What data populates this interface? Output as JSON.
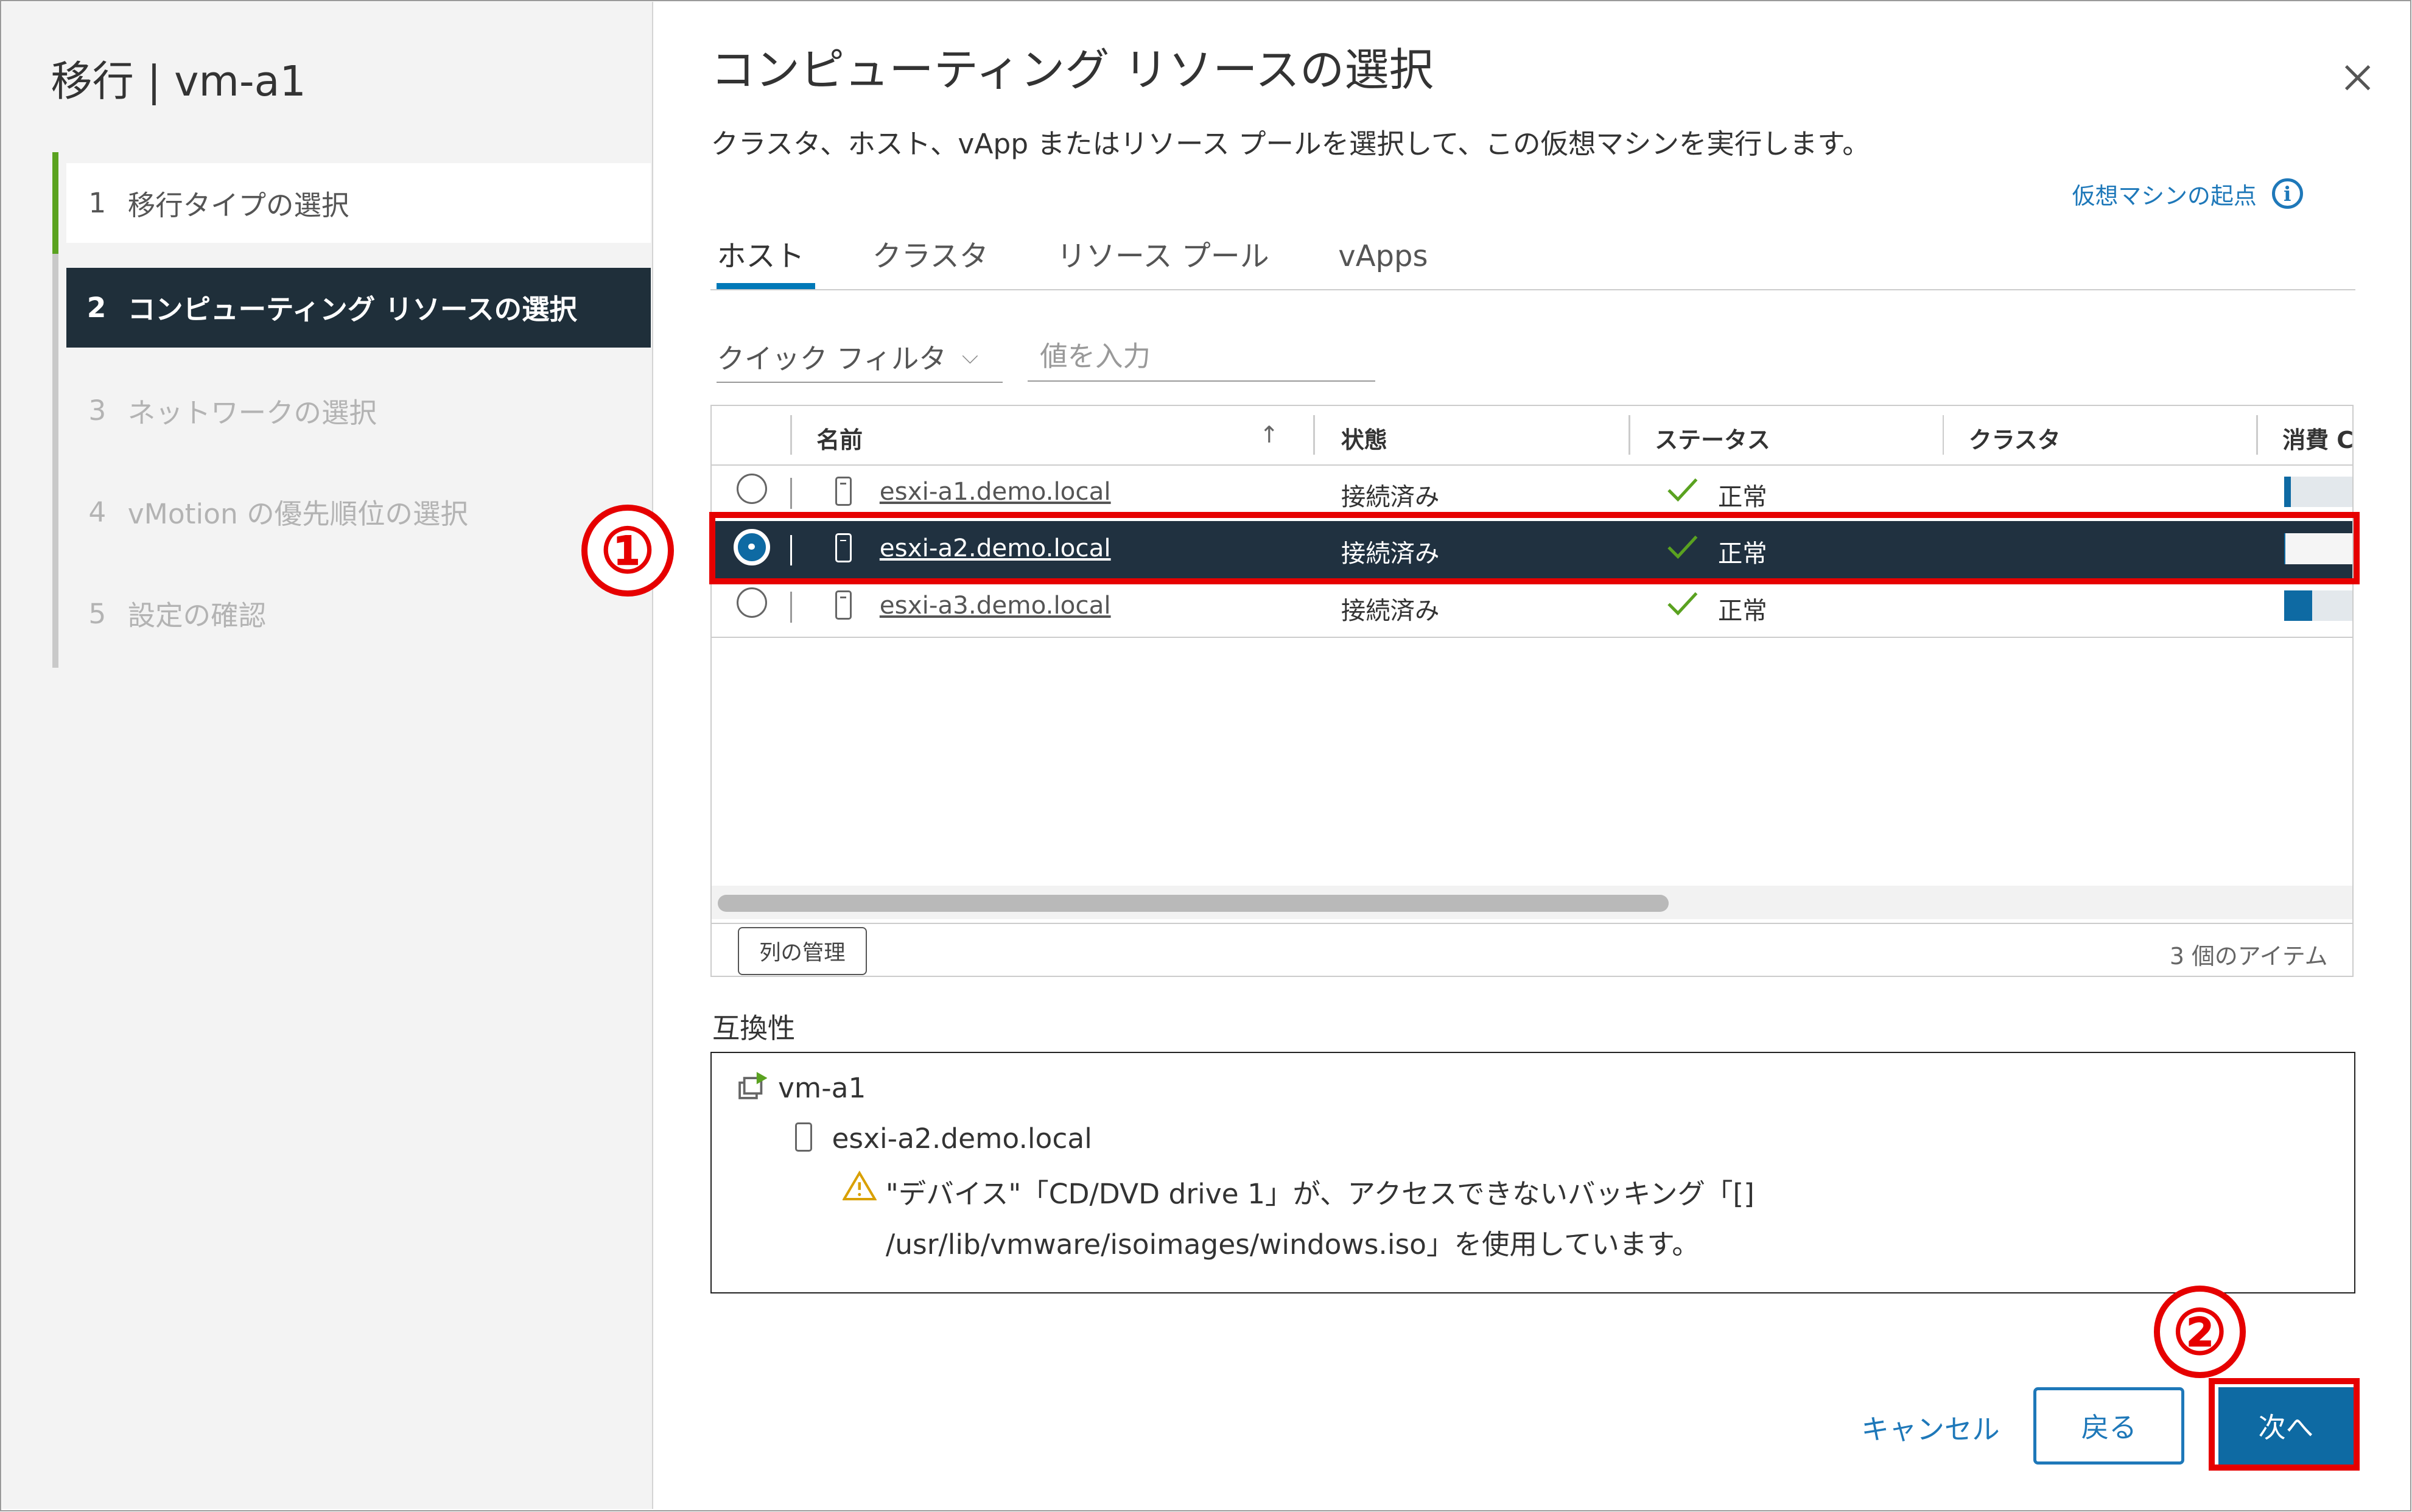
{
  "dialog": {
    "title": "移行 | vm-a1"
  },
  "steps": [
    {
      "num": "1",
      "label": "移行タイプの選択",
      "state": "done"
    },
    {
      "num": "2",
      "label": "コンピューティング リソースの選択",
      "state": "active"
    },
    {
      "num": "3",
      "label": "ネットワークの選択",
      "state": "pending"
    },
    {
      "num": "4",
      "label": "vMotion の優先順位の選択",
      "state": "pending"
    },
    {
      "num": "5",
      "label": "設定の確認",
      "state": "pending"
    }
  ],
  "main": {
    "title": "コンピューティング リソースの選択",
    "subtitle": "クラスタ、ホスト、vApp またはリソース プールを選択して、この仮想マシンを実行します。",
    "origin_link": "仮想マシンの起点",
    "info_icon_glyph": "i"
  },
  "tabs": [
    {
      "label": "ホスト",
      "active": true
    },
    {
      "label": "クラスタ",
      "active": false
    },
    {
      "label": "リソース プール",
      "active": false
    },
    {
      "label": "vApps",
      "active": false
    }
  ],
  "filter": {
    "quick_filter": "クイック フィルタ",
    "chevron": "⌵",
    "placeholder": "値を入力"
  },
  "table": {
    "columns": [
      "名前",
      "状態",
      "ステータス",
      "クラスタ",
      "消費 C"
    ],
    "sort_icon": "↑",
    "rows": [
      {
        "name": "esxi-a1.demo.local",
        "state": "接続済み",
        "status": "正常",
        "cluster": "",
        "selected": false,
        "cpu_usage": 0.1
      },
      {
        "name": "esxi-a2.demo.local",
        "state": "接続済み",
        "status": "正常",
        "cluster": "",
        "selected": true,
        "cpu_usage": 0.02
      },
      {
        "name": "esxi-a3.demo.local",
        "state": "接続済み",
        "status": "正常",
        "cluster": "",
        "selected": false,
        "cpu_usage": 0.4
      }
    ],
    "manage_columns": "列の管理",
    "item_count": "3 個のアイテム"
  },
  "compatibility": {
    "label": "互換性",
    "vm": "vm-a1",
    "host": "esxi-a2.demo.local",
    "warning_line1": "\"デバイス\"「CD/DVD drive 1」が、アクセスできないバッキング「[]",
    "warning_line2": "/usr/lib/vmware/isoimages/windows.iso」を使用しています。"
  },
  "footer": {
    "cancel": "キャンセル",
    "back": "戻る",
    "next": "次へ"
  },
  "annotations": {
    "marker1": "①",
    "marker2": "②"
  },
  "colors": {
    "accent": "#0e6aa3",
    "selected_row": "#203140",
    "done_step": "#5aa220",
    "annotation": "#e60000",
    "link": "#1e78b9"
  },
  "icons": {
    "close": "close-icon",
    "host": "host-icon",
    "vm": "vm-icon",
    "warning": "warning-icon",
    "check": "check-icon",
    "info": "info-icon"
  }
}
